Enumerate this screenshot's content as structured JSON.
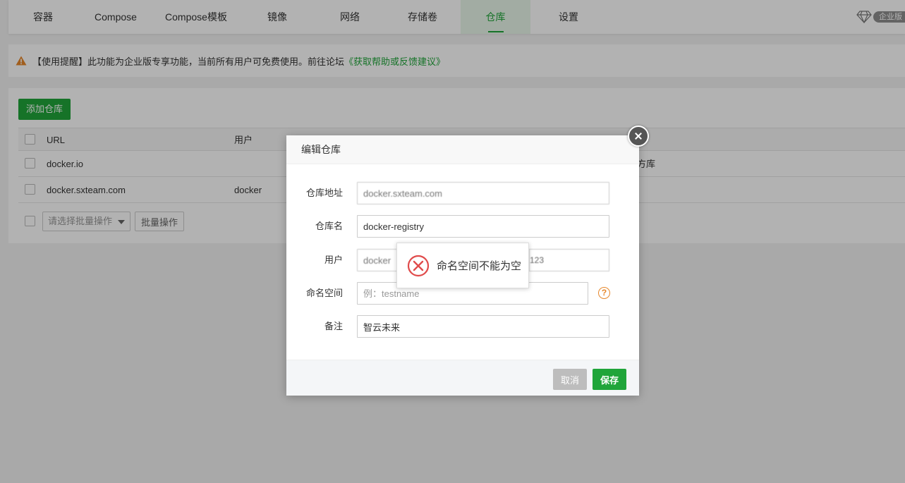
{
  "tabs": [
    {
      "label": "容器",
      "active": false
    },
    {
      "label": "Compose",
      "active": false
    },
    {
      "label": "Compose模板",
      "active": false
    },
    {
      "label": "镜像",
      "active": false
    },
    {
      "label": "网络",
      "active": false
    },
    {
      "label": "存储卷",
      "active": false
    },
    {
      "label": "仓库",
      "active": true
    },
    {
      "label": "设置",
      "active": false
    }
  ],
  "enterprise_badge": "企业版",
  "notice": {
    "text": "【使用提醒】此功能为企业版专享功能，当前所有用户可免费使用。前往论坛",
    "link": "《获取帮助或反馈建议》"
  },
  "panel": {
    "add_button": "添加仓库",
    "columns": [
      "URL",
      "用户"
    ],
    "rows": [
      {
        "url": "docker.io",
        "user": "",
        "extra": "方库"
      },
      {
        "url": "docker.sxteam.com",
        "user": "docker",
        "extra": ""
      }
    ],
    "batch_select_placeholder": "请选择批量操作",
    "batch_button": "批量操作"
  },
  "modal": {
    "title": "编辑仓库",
    "fields": {
      "address": {
        "label": "仓库地址",
        "value": "docker.sxteam.com"
      },
      "name": {
        "label": "仓库名",
        "value": "docker-registry"
      },
      "user": {
        "label": "用户",
        "value": "docker",
        "password_tail": "123"
      },
      "namespace": {
        "label": "命名空间",
        "value": "",
        "placeholder": "例：testname"
      },
      "remark": {
        "label": "备注",
        "value": "智云未来"
      }
    },
    "cancel_label": "取消",
    "save_label": "保存"
  },
  "toast": {
    "message": "命名空间不能为空"
  },
  "colors": {
    "accent": "#20a53a",
    "error": "#e04b4b",
    "warning": "#e6872b"
  }
}
